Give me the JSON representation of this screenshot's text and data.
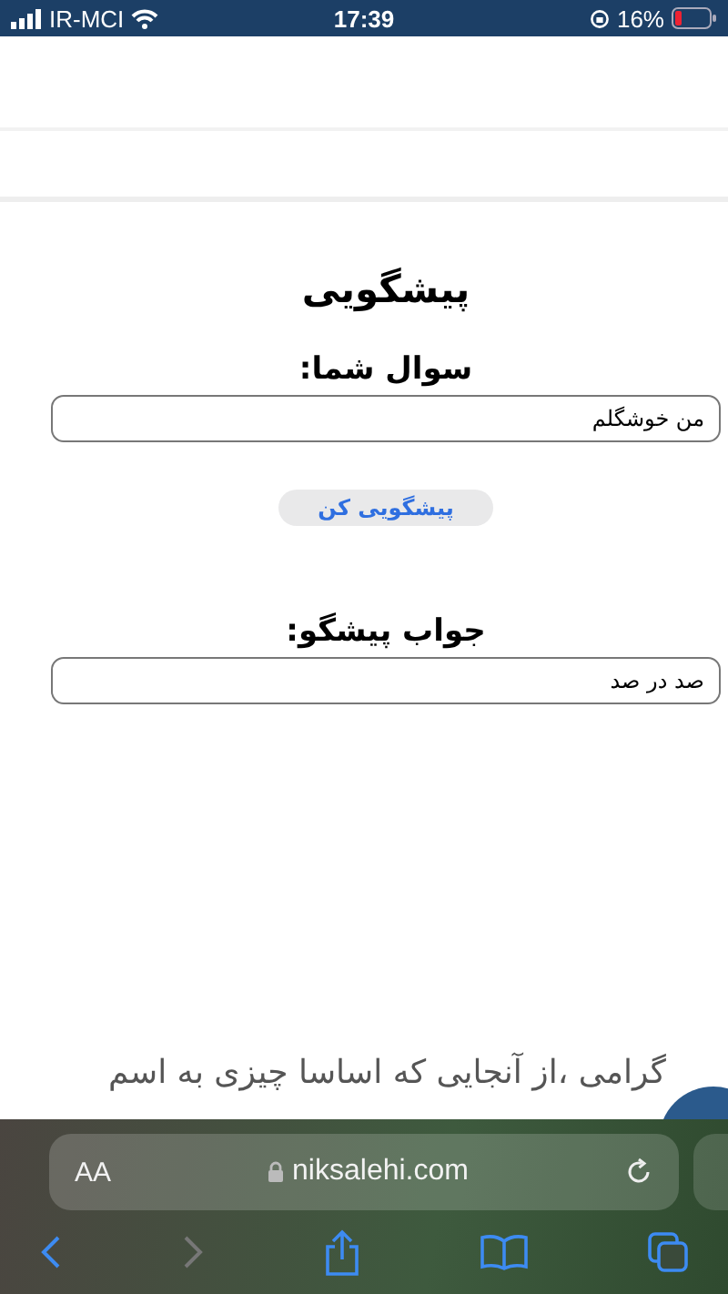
{
  "status_bar": {
    "carrier": "IR-MCI",
    "time": "17:39",
    "battery": "16%"
  },
  "page": {
    "title": "پیشگویی",
    "question_label": "سوال شما:",
    "question_value": "من خوشگلم",
    "button": "پیشگویی کن",
    "answer_label": "جواب پیشگو:",
    "answer_value": "صد در صد",
    "body_text": "گرامی ،از آنجایی که اساسا چیزی به اسم"
  },
  "browser": {
    "text_size": "AA",
    "url": "niksalehi.com",
    "nav": [
      {
        "kind": "back",
        "disabled": false
      },
      {
        "kind": "forward",
        "disabled": true
      },
      {
        "kind": "share",
        "disabled": false
      },
      {
        "kind": "bookmarks",
        "disabled": false
      },
      {
        "kind": "tabs",
        "disabled": false
      }
    ]
  }
}
